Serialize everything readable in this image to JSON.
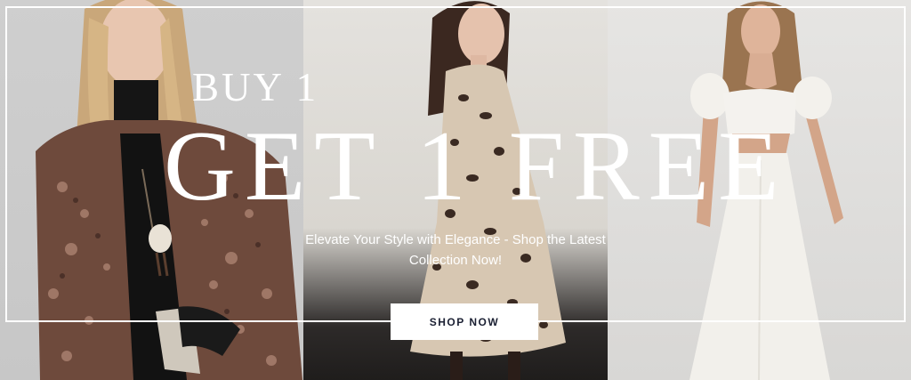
{
  "hero": {
    "headline_small": "BUY 1",
    "headline_big": "GET 1 FREE",
    "tagline_line1": "Elevate Your Style with Elegance - Shop the Latest",
    "tagline_line2": "Collection Now!",
    "cta_label": "SHOP NOW"
  },
  "colors": {
    "text": "#ffffff",
    "cta_background": "#ffffff",
    "cta_text": "#1b2033"
  },
  "images": [
    {
      "name": "model-floral-jacket-photo"
    },
    {
      "name": "model-leopard-dress-photo"
    },
    {
      "name": "model-white-dress-photo"
    }
  ]
}
